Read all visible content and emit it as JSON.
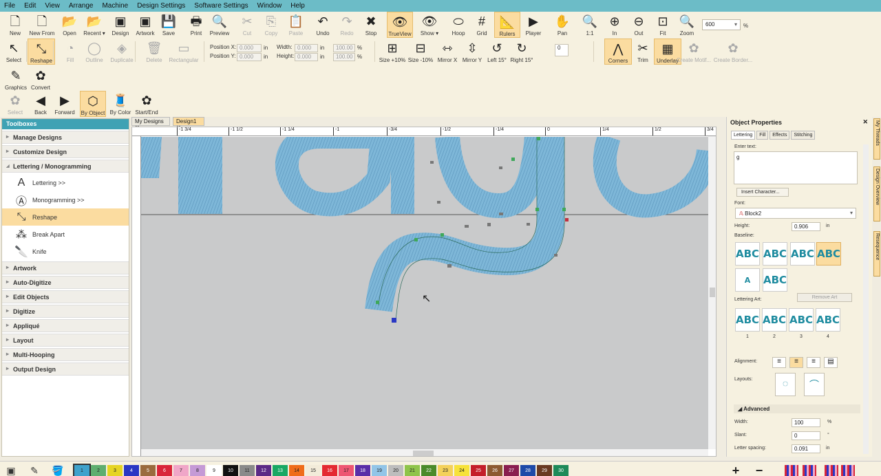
{
  "menu": [
    "File",
    "Edit",
    "View",
    "Arrange",
    "Machine",
    "Design Settings",
    "Software Settings",
    "Window",
    "Help"
  ],
  "toolbar_main": [
    {
      "label": "New",
      "icon": "new-doc-icon",
      "glyph": "🗋"
    },
    {
      "label": "New From",
      "icon": "new-from-icon",
      "glyph": "🗋"
    },
    {
      "label": "Open",
      "icon": "open-folder-icon",
      "glyph": "📂"
    },
    {
      "label": "Recent ▾",
      "icon": "recent-icon",
      "glyph": "📂"
    },
    {
      "label": "Design",
      "icon": "design-icon",
      "glyph": "▣"
    },
    {
      "label": "Artwork",
      "icon": "artwork-icon",
      "glyph": "▣"
    },
    {
      "label": "Save",
      "icon": "save-icon",
      "glyph": "💾"
    },
    {
      "label": "Print",
      "icon": "print-icon",
      "glyph": "🖶"
    },
    {
      "label": "Preview",
      "icon": "preview-icon",
      "glyph": "🔍"
    },
    {
      "label": "Cut",
      "icon": "cut-icon",
      "glyph": "✂"
    },
    {
      "label": "Copy",
      "icon": "copy-icon",
      "glyph": "⎘"
    },
    {
      "label": "Paste",
      "icon": "paste-icon",
      "glyph": "📋"
    },
    {
      "label": "Undo",
      "icon": "undo-icon",
      "glyph": "↶"
    },
    {
      "label": "Redo",
      "icon": "redo-icon",
      "glyph": "↷"
    },
    {
      "label": "Stop",
      "icon": "stop-icon",
      "glyph": "✖"
    },
    {
      "label": "TrueView",
      "icon": "trueview-eye-icon",
      "glyph": "👁"
    },
    {
      "label": "Show ▾",
      "icon": "show-eye-icon",
      "glyph": "👁"
    },
    {
      "label": "Hoop",
      "icon": "hoop-icon",
      "glyph": "⬭"
    },
    {
      "label": "Grid",
      "icon": "grid-icon",
      "glyph": "#"
    },
    {
      "label": "Rulers",
      "icon": "rulers-icon",
      "glyph": "📐"
    },
    {
      "label": "Player",
      "icon": "player-icon",
      "glyph": "▶"
    },
    {
      "label": "Pan",
      "icon": "pan-hand-icon",
      "glyph": "✋"
    },
    {
      "label": "1:1",
      "icon": "zoom-1to1-icon",
      "glyph": "🔍"
    },
    {
      "label": "In",
      "icon": "zoom-in-icon",
      "glyph": "⊕"
    },
    {
      "label": "Out",
      "icon": "zoom-out-icon",
      "glyph": "⊖"
    },
    {
      "label": "Fit",
      "icon": "zoom-fit-icon",
      "glyph": "⊡"
    },
    {
      "label": "Zoom",
      "icon": "zoom-icon",
      "glyph": "🔍"
    }
  ],
  "zoom_value": "600",
  "zoom_unit": "%",
  "toolbar_edit": [
    {
      "label": "Select",
      "icon": "select-arrow-icon",
      "glyph": "↖"
    },
    {
      "label": "Reshape",
      "icon": "reshape-icon",
      "glyph": "⤡"
    },
    {
      "label": "Fill",
      "icon": "fill-icon",
      "glyph": "◔"
    },
    {
      "label": "Outline",
      "icon": "outline-icon",
      "glyph": "◯"
    },
    {
      "label": "Duplicate",
      "icon": "duplicate-icon",
      "glyph": "◈"
    },
    {
      "label": "Delete",
      "icon": "delete-icon",
      "glyph": "🗑"
    },
    {
      "label": "Rectangular",
      "icon": "rectangular-icon",
      "glyph": "▭"
    }
  ],
  "position": {
    "x_label": "Position X:",
    "y_label": "Position Y:",
    "x": "0.000",
    "y": "0.000",
    "unit": "in"
  },
  "size": {
    "w_label": "Width:",
    "h_label": "Height:",
    "w": "0.000",
    "h": "0.000",
    "unit": "in",
    "pw": "100.00",
    "ph": "100.00",
    "punit": "%"
  },
  "toolbar_transform": [
    {
      "label": "Size +10%",
      "icon": "size-plus-icon",
      "glyph": "⊞"
    },
    {
      "label": "Size -10%",
      "icon": "size-minus-icon",
      "glyph": "⊟"
    },
    {
      "label": "Mirror X",
      "icon": "mirror-x-icon",
      "glyph": "⇿"
    },
    {
      "label": "Mirror Y",
      "icon": "mirror-y-icon",
      "glyph": "⇳"
    },
    {
      "label": "Left 15°",
      "icon": "rotate-left-icon",
      "glyph": "↺"
    },
    {
      "label": "Right 15°",
      "icon": "rotate-right-icon",
      "glyph": "↻"
    }
  ],
  "rotate_value": "0",
  "toolbar_right": [
    {
      "label": "Corners",
      "icon": "corners-icon",
      "glyph": "⋀"
    },
    {
      "label": "Trim",
      "icon": "trim-icon",
      "glyph": "✂"
    },
    {
      "label": "Underlay",
      "icon": "underlay-icon",
      "glyph": "▦"
    },
    {
      "label": "Create Motif...",
      "icon": "create-motif-icon",
      "glyph": "✿"
    },
    {
      "label": "Create Border...",
      "icon": "create-border-icon",
      "glyph": "✿"
    }
  ],
  "toolbar_graphics": [
    {
      "label": "Graphics",
      "icon": "graphics-pencil-icon",
      "glyph": "✎"
    },
    {
      "label": "Convert",
      "icon": "convert-icon",
      "glyph": "✿"
    }
  ],
  "toolbar_sequence": [
    {
      "label": "Select",
      "icon": "sequence-select-icon",
      "glyph": "✿"
    },
    {
      "label": "Back",
      "icon": "back-arrow-icon",
      "glyph": "◀"
    },
    {
      "label": "Forward",
      "icon": "forward-arrow-icon",
      "glyph": "▶"
    },
    {
      "label": "By Object",
      "icon": "by-object-icon",
      "glyph": "⬡"
    },
    {
      "label": "By Color",
      "icon": "by-color-icon",
      "glyph": "🧵"
    },
    {
      "label": "Start/End",
      "icon": "start-end-icon",
      "glyph": "✿"
    }
  ],
  "toolboxes": {
    "title": "Toolboxes",
    "cats_top": [
      "Manage Designs",
      "Customize Design",
      "Lettering / Monogramming"
    ],
    "lettering_items": [
      {
        "label": "Lettering >>",
        "icon": "lettering-icon",
        "glyph": "A"
      },
      {
        "label": "Monogramming >>",
        "icon": "monogramming-icon",
        "glyph": "Ⓐ"
      },
      {
        "label": "Reshape",
        "icon": "reshape-tool-icon",
        "glyph": "⤡"
      },
      {
        "label": "Break Apart",
        "icon": "break-apart-icon",
        "glyph": "⁂"
      },
      {
        "label": "Knife",
        "icon": "knife-icon",
        "glyph": "🔪"
      }
    ],
    "cats_bottom": [
      "Artwork",
      "Auto-Digitize",
      "Edit Objects",
      "Digitize",
      "Appliqué",
      "Layout",
      "Multi-Hooping",
      "Output Design"
    ]
  },
  "doc_tabs": [
    "My Designs",
    "Design1"
  ],
  "ruler_labels": [
    "-1 3/4",
    "-1 1/2",
    "-1 1/4",
    "-1",
    "-3/4",
    "-1/2",
    "-1/4",
    "0",
    "1/4",
    "1/2",
    "3/4"
  ],
  "properties": {
    "title": "Object Properties",
    "tabs": [
      "Lettering",
      "Fill",
      "Effects",
      "Stitching"
    ],
    "enter_text_label": "Enter text:",
    "text_value": "g",
    "insert_char": "Insert Character...",
    "font_label": "Font:",
    "font_value": "Block2",
    "height_label": "Height:",
    "height_value": "0.906",
    "height_unit": "in",
    "baseline_label": "Baseline:",
    "baseline_glyph": "ABC",
    "baseline_small": "A",
    "lettering_art_label": "Lettering Art:",
    "remove_art": "Remove Art",
    "art_numbers": [
      "1",
      "2",
      "3",
      "4"
    ],
    "alignment_label": "Alignment:",
    "layouts_label": "Layouts:",
    "advanced_label": "Advanced",
    "width_label": "Width:",
    "width_value": "100",
    "width_unit": "%",
    "slant_label": "Slant:",
    "slant_value": "0",
    "slant_unit": "°",
    "spacing_label": "Letter spacing:",
    "spacing_value": "0.091",
    "spacing_unit": "in"
  },
  "side_tabs": [
    "My Threads",
    "Design Overview",
    "Resequence"
  ],
  "palette": [
    {
      "n": "1",
      "c": "#3fa2cc"
    },
    {
      "n": "2",
      "c": "#5fae6f"
    },
    {
      "n": "3",
      "c": "#e6d422"
    },
    {
      "n": "4",
      "c": "#2a38c4"
    },
    {
      "n": "5",
      "c": "#9a6b3e"
    },
    {
      "n": "6",
      "c": "#d9253a"
    },
    {
      "n": "7",
      "c": "#f0a6c8"
    },
    {
      "n": "8",
      "c": "#c59ad6"
    },
    {
      "n": "9",
      "c": "#ffffff"
    },
    {
      "n": "10",
      "c": "#111111"
    },
    {
      "n": "11",
      "c": "#8a8a8a"
    },
    {
      "n": "12",
      "c": "#5b2a86"
    },
    {
      "n": "13",
      "c": "#19a864"
    },
    {
      "n": "14",
      "c": "#ef6c1a"
    },
    {
      "n": "15",
      "c": "#f2ebd9"
    },
    {
      "n": "16",
      "c": "#e42a32"
    },
    {
      "n": "17",
      "c": "#ee5572"
    },
    {
      "n": "18",
      "c": "#5a2ea8"
    },
    {
      "n": "19",
      "c": "#92c5e8"
    },
    {
      "n": "20",
      "c": "#bdbdbd"
    },
    {
      "n": "21",
      "c": "#8fc44a"
    },
    {
      "n": "22",
      "c": "#4a8a2a"
    },
    {
      "n": "23",
      "c": "#f4d15a"
    },
    {
      "n": "24",
      "c": "#f7e23a"
    },
    {
      "n": "25",
      "c": "#c41e2a"
    },
    {
      "n": "26",
      "c": "#8d5a32"
    },
    {
      "n": "27",
      "c": "#8a1e50"
    },
    {
      "n": "28",
      "c": "#1e4aa8"
    },
    {
      "n": "29",
      "c": "#6a3a22"
    },
    {
      "n": "30",
      "c": "#1e8a5a"
    }
  ],
  "palette_tools": [
    {
      "icon": "thread-cone-icon",
      "glyph": "▣"
    },
    {
      "icon": "eyedropper-icon",
      "glyph": "✎"
    },
    {
      "icon": "bucket-fill-icon",
      "glyph": "🪣"
    }
  ],
  "palette_right": [
    {
      "icon": "add-color-icon",
      "glyph": "+"
    },
    {
      "icon": "remove-color-icon",
      "glyph": "−"
    }
  ],
  "colors": {
    "accent": "#6cbcc7",
    "active": "#fbdca0",
    "thread": "#7ab3d6",
    "canvas": "#c9cacb"
  }
}
